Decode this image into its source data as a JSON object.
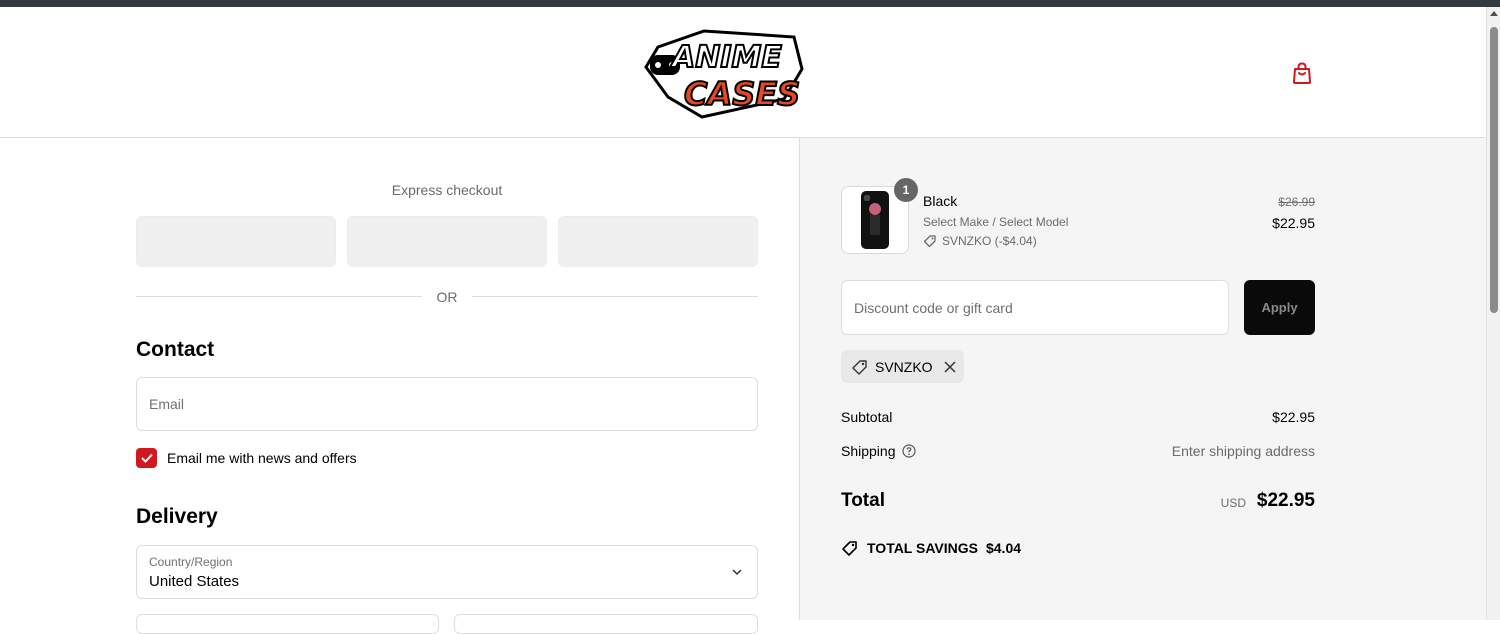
{
  "brand": {
    "logo_line1": "ANIME",
    "logo_line2": "CASES",
    "accent_color": "#d0181f"
  },
  "header": {
    "cart_icon": "shopping-bag-icon"
  },
  "express_checkout": {
    "title": "Express checkout",
    "separator": "OR"
  },
  "contact": {
    "title": "Contact",
    "email_placeholder": "Email",
    "newsletter_label": "Email me with news and offers",
    "newsletter_checked": true
  },
  "delivery": {
    "title": "Delivery",
    "country_label": "Country/Region",
    "country_value": "United States"
  },
  "order": {
    "item": {
      "quantity": "1",
      "name": "Black",
      "variant": "Select Make / Select Model",
      "discount_line": "SVNZKO (-$4.04)",
      "original_price": "$26.99",
      "price": "$22.95"
    },
    "discount_placeholder": "Discount code or gift card",
    "apply_label": "Apply",
    "applied_code": "SVNZKO",
    "subtotal_label": "Subtotal",
    "subtotal_value": "$22.95",
    "shipping_label": "Shipping",
    "shipping_value": "Enter shipping address",
    "total_label": "Total",
    "total_currency": "USD",
    "total_value": "$22.95",
    "savings_label": "TOTAL SAVINGS",
    "savings_value": "$4.04"
  }
}
